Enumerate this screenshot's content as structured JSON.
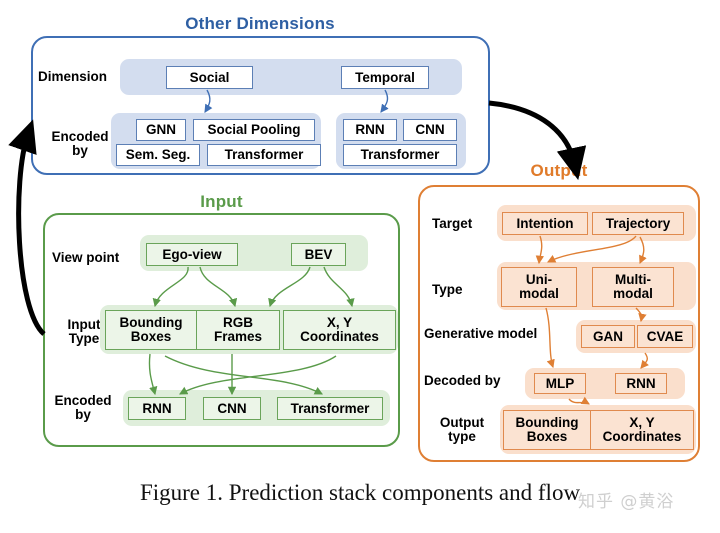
{
  "figure": {
    "caption": "Figure 1. Prediction stack components and flow",
    "watermark": "知乎 @黄浴"
  },
  "colors": {
    "blue_border": "#3f6fb5",
    "blue_title": "#2e5fa3",
    "blue_band": "#d3ddef",
    "green_border": "#5a9b4a",
    "green_title": "#5a9b4a",
    "green_band": "#dfeedb",
    "orange_border": "#df7f34",
    "orange_title": "#e07b2a",
    "orange_band": "#fadfcc",
    "arrow_black": "#000000"
  },
  "other_dimensions": {
    "title": "Other Dimensions",
    "rows": [
      {
        "label": "Dimension",
        "label_lines": [
          "Dimension"
        ]
      },
      {
        "label": "Encoded by",
        "label_lines": [
          "Encoded",
          "by"
        ]
      }
    ],
    "dimension": {
      "social": "Social",
      "temporal": "Temporal"
    },
    "encoded_by": {
      "social": [
        "GNN",
        "Social Pooling",
        "Sem. Seg.",
        "Transformer"
      ],
      "temporal": [
        "RNN",
        "CNN",
        "Transformer"
      ]
    }
  },
  "input": {
    "title": "Input",
    "rows": [
      {
        "label": "View point",
        "label_lines": [
          "View point"
        ]
      },
      {
        "label": "Input Type",
        "label_lines": [
          "Input",
          "Type"
        ]
      },
      {
        "label": "Encoded by",
        "label_lines": [
          "Encoded",
          "by"
        ]
      }
    ],
    "view_point": [
      "Ego-view",
      "BEV"
    ],
    "input_type": [
      {
        "lines": [
          "Bounding",
          "Boxes"
        ]
      },
      {
        "lines": [
          "RGB",
          "Frames"
        ]
      },
      {
        "lines": [
          "X, Y",
          "Coordinates"
        ]
      }
    ],
    "encoded_by": [
      "RNN",
      "CNN",
      "Transformer"
    ]
  },
  "output": {
    "title": "Output",
    "rows": [
      {
        "label": "Target",
        "label_lines": [
          "Target"
        ]
      },
      {
        "label": "Type",
        "label_lines": [
          "Type"
        ]
      },
      {
        "label": "Generative model",
        "label_lines": [
          "Generative model"
        ]
      },
      {
        "label": "Decoded by",
        "label_lines": [
          "Decoded by"
        ]
      },
      {
        "label": "Output type",
        "label_lines": [
          "Output",
          "type"
        ]
      }
    ],
    "target": [
      "Intention",
      "Trajectory"
    ],
    "type": [
      {
        "lines": [
          "Uni-",
          "modal"
        ]
      },
      {
        "lines": [
          "Multi-",
          "modal"
        ]
      }
    ],
    "generative_model": [
      "GAN",
      "CVAE"
    ],
    "decoded_by": [
      "MLP",
      "RNN"
    ],
    "output_type": [
      {
        "lines": [
          "Bounding",
          "Boxes"
        ]
      },
      {
        "lines": [
          "X, Y",
          "Coordinates"
        ]
      }
    ]
  }
}
